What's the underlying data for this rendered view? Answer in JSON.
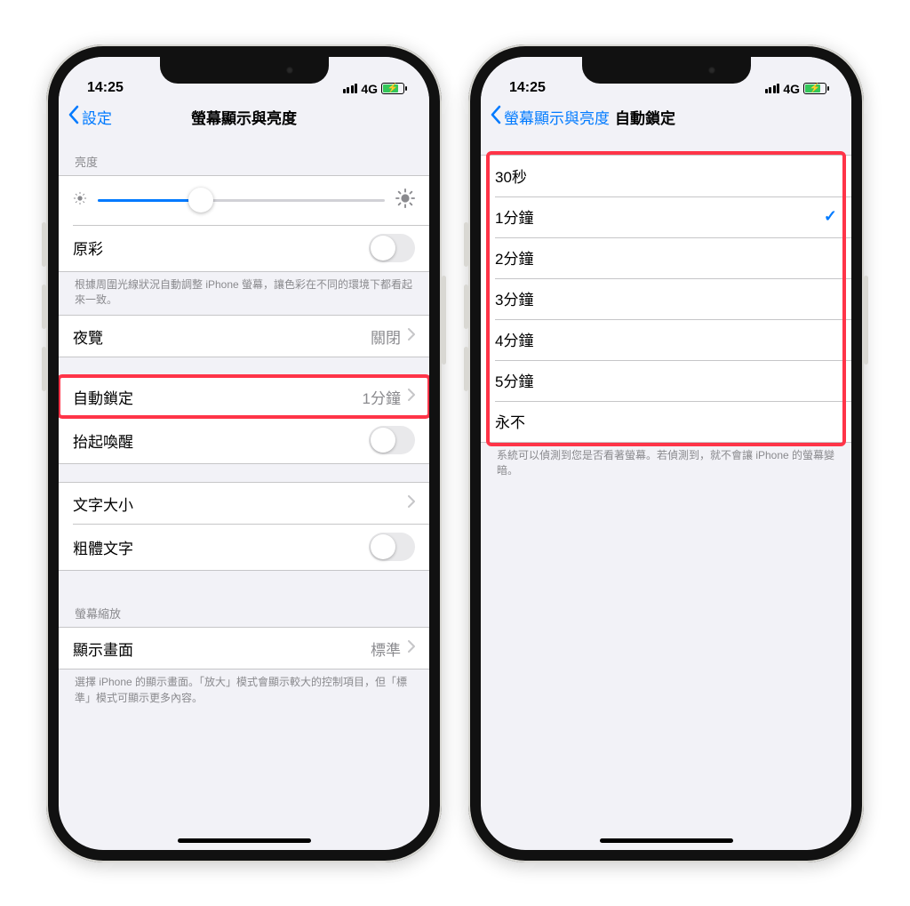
{
  "status": {
    "time": "14:25",
    "carrier": "4G"
  },
  "left": {
    "back": "設定",
    "title": "螢幕顯示與亮度",
    "brightness_header": "亮度",
    "true_tone_label": "原彩",
    "true_tone_footer": "根據周圍光線狀況自動調整 iPhone 螢幕，讓色彩在不同的環境下都看起來一致。",
    "night_shift_label": "夜覽",
    "night_shift_value": "關閉",
    "auto_lock_label": "自動鎖定",
    "auto_lock_value": "1分鐘",
    "raise_to_wake_label": "抬起喚醒",
    "text_size_label": "文字大小",
    "bold_text_label": "粗體文字",
    "zoom_header": "螢幕縮放",
    "display_zoom_label": "顯示畫面",
    "display_zoom_value": "標準",
    "zoom_footer": "選擇 iPhone 的顯示畫面。「放大」模式會顯示較大的控制項目，但「標準」模式可顯示更多內容。",
    "brightness_percent": 36
  },
  "right": {
    "back": "螢幕顯示與亮度",
    "title": "自動鎖定",
    "options": [
      {
        "label": "30秒",
        "checked": false
      },
      {
        "label": "1分鐘",
        "checked": true
      },
      {
        "label": "2分鐘",
        "checked": false
      },
      {
        "label": "3分鐘",
        "checked": false
      },
      {
        "label": "4分鐘",
        "checked": false
      },
      {
        "label": "5分鐘",
        "checked": false
      },
      {
        "label": "永不",
        "checked": false
      }
    ],
    "footer": "系統可以偵測到您是否看著螢幕。若偵測到，就不會讓 iPhone 的螢幕變暗。"
  },
  "highlight_color": "#ff3448"
}
